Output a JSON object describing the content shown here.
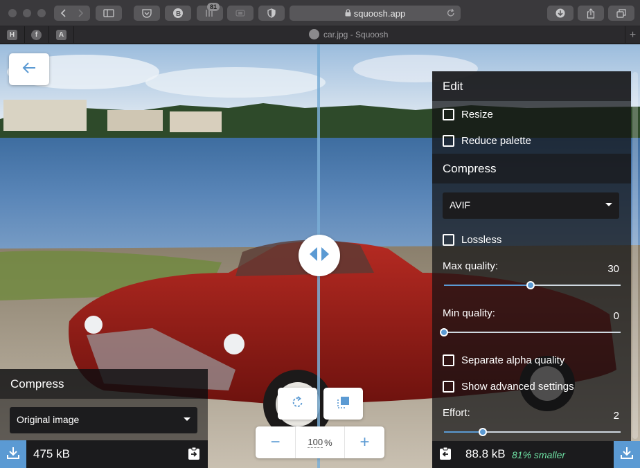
{
  "browser": {
    "address": "squoosh.app",
    "tab_title": "car.jpg - Squoosh",
    "tab_badge": "81",
    "favicons": [
      "H",
      "f",
      "A"
    ],
    "new_tab_label": "+"
  },
  "left_panel": {
    "title": "Compress",
    "method": "Original image",
    "size": "475 kB"
  },
  "controls": {
    "zoom_value": "100",
    "zoom_unit": "%",
    "zoom_out_label": "−",
    "zoom_in_label": "+"
  },
  "right_panel": {
    "edit_title": "Edit",
    "resize_label": "Resize",
    "reduce_palette_label": "Reduce palette",
    "compress_title": "Compress",
    "codec": "AVIF",
    "lossless_label": "Lossless",
    "max_quality_label": "Max quality:",
    "max_quality_value": "30",
    "min_quality_label": "Min quality:",
    "min_quality_value": "0",
    "separate_alpha_label": "Separate alpha quality",
    "advanced_label": "Show advanced settings",
    "effort_label": "Effort:",
    "effort_value": "2",
    "size": "88.8 kB",
    "savings": "81% smaller"
  },
  "sliders": {
    "max_quality_fraction": 0.49,
    "min_quality_fraction": 0.0,
    "effort_fraction": 0.22
  },
  "colors": {
    "accent": "#5b9ad3",
    "savings": "#6ee2a4",
    "panel": "#1b1b1d"
  }
}
